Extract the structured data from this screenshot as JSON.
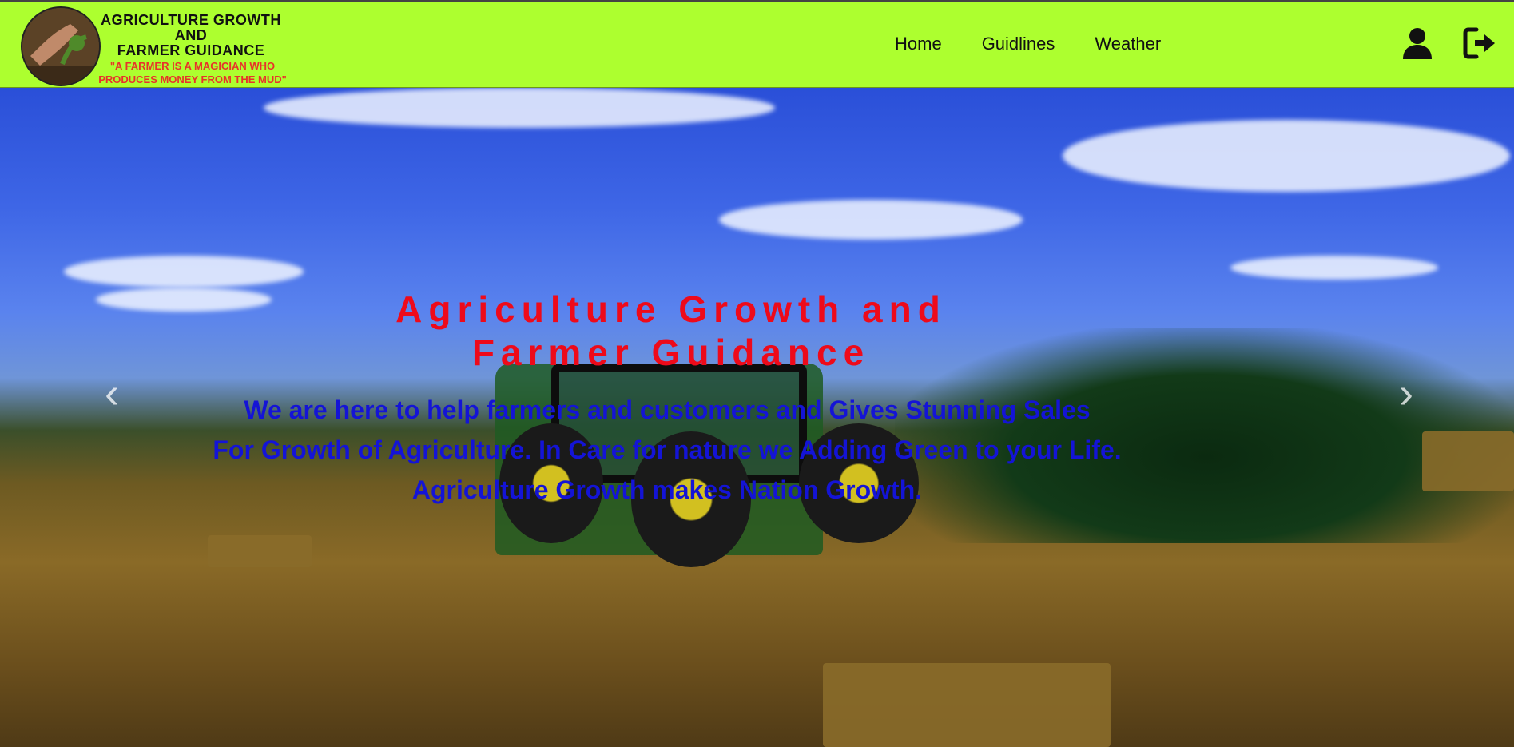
{
  "header": {
    "logo": {
      "title_lines": [
        "AGRICULTURE GROWTH",
        "AND",
        "FARMER GUIDANCE"
      ],
      "tagline": "\"A FARMER IS A MAGICIAN WHO PRODUCES MONEY FROM THE MUD\""
    },
    "nav": [
      {
        "label": "Home"
      },
      {
        "label": "Guidlines"
      },
      {
        "label": "Weather"
      }
    ],
    "icons": {
      "profile": "user-icon",
      "logout": "logout-icon"
    }
  },
  "hero": {
    "title_lines": [
      "Agriculture Growth and",
      "Farmer Guidance"
    ],
    "text_lines": [
      "We are here to help farmers and customers and Gives Stunning Sales",
      "For Growth of Agriculture. In Care for nature we Adding Green to your Life.",
      "Agriculture Growth makes Nation Growth."
    ],
    "prev_icon": "chevron-left-icon",
    "next_icon": "chevron-right-icon"
  },
  "colors": {
    "header_bg": "#adff2f",
    "hero_title": "#ee0a1a",
    "hero_text": "#1414d6",
    "tagline": "#e8322a"
  }
}
